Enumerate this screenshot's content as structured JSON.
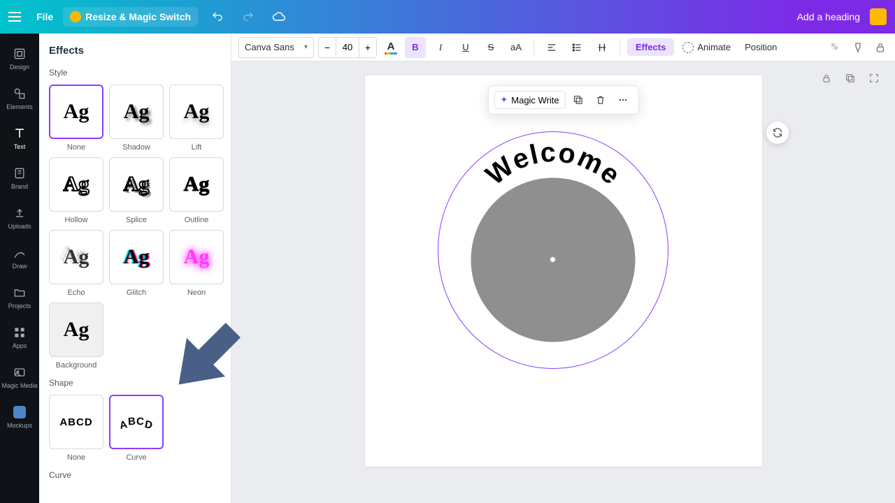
{
  "topbar": {
    "file": "File",
    "resize": "Resize & Magic Switch",
    "title": "Add a heading"
  },
  "rail": {
    "design": "Design",
    "elements": "Elements",
    "text": "Text",
    "brand": "Brand",
    "uploads": "Uploads",
    "draw": "Draw",
    "projects": "Projects",
    "apps": "Apps",
    "magic_media": "Magic Media",
    "mockups": "Mockups"
  },
  "panel": {
    "heading": "Effects",
    "style_heading": "Style",
    "shape_heading": "Shape",
    "curve_heading": "Curve",
    "sample": "Ag",
    "abcd": "ABCD",
    "styles": {
      "none": "None",
      "shadow": "Shadow",
      "lift": "Lift",
      "hollow": "Hollow",
      "splice": "Splice",
      "outline": "Outline",
      "echo": "Echo",
      "glitch": "Glitch",
      "neon": "Neon",
      "background": "Background"
    },
    "shapes": {
      "none": "None",
      "curve": "Curve"
    },
    "selected_style": "none",
    "selected_shape": "curve"
  },
  "toolbar": {
    "font": "Canva Sans",
    "size": "40",
    "effects": "Effects",
    "animate": "Animate",
    "position": "Position",
    "aA": "aA"
  },
  "canvas": {
    "magic_write": "Magic Write",
    "curved_text": "Welcome"
  }
}
